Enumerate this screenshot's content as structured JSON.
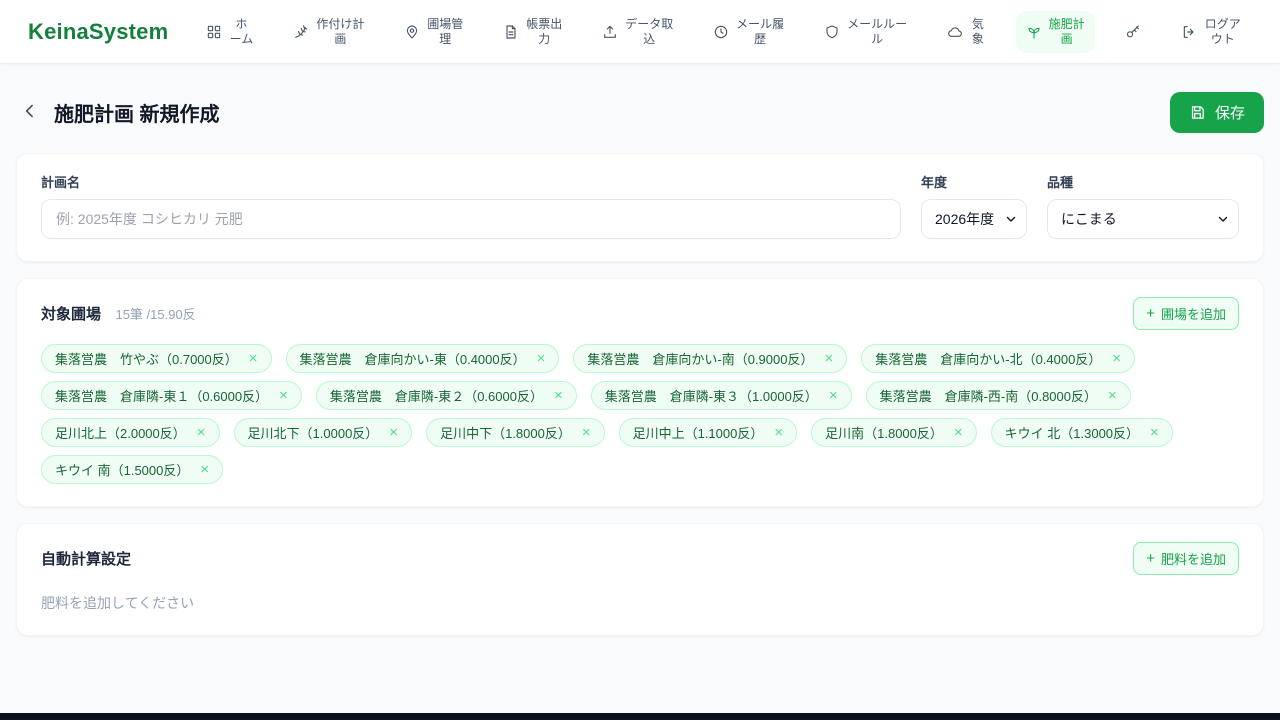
{
  "colors": {
    "accent": "#16a34a",
    "accent_dark": "#15803d",
    "accent_bg": "#f0fdf4",
    "accent_border": "#86efac",
    "tag_border": "#bbf7d0",
    "tag_text": "#166534",
    "text_dark": "#0f172a",
    "text_muted": "#94a3b8",
    "page_bg": "#f8fafc",
    "nav_text": "#475569"
  },
  "header": {
    "logo": "KeinaSystem",
    "nav": [
      {
        "label": "ホーム",
        "icon": "grid",
        "active": false
      },
      {
        "label": "作付け計画",
        "icon": "wheat",
        "active": false
      },
      {
        "label": "圃場管理",
        "icon": "map-pin",
        "active": false
      },
      {
        "label": "帳票出力",
        "icon": "document",
        "active": false
      },
      {
        "label": "データ取込",
        "icon": "upload",
        "active": false
      },
      {
        "label": "メール履歴",
        "icon": "history",
        "active": false
      },
      {
        "label": "メールルール",
        "icon": "shield",
        "active": false
      },
      {
        "label": "気象",
        "icon": "cloud",
        "active": false
      },
      {
        "label": "施肥計画",
        "icon": "sprout",
        "active": true
      },
      {
        "label": "",
        "icon": "key",
        "active": false
      },
      {
        "label": "ログアウト",
        "icon": "logout",
        "active": false
      }
    ]
  },
  "page": {
    "title": "施肥計画 新規作成",
    "save_label": "保存"
  },
  "form": {
    "plan_name_label": "計画名",
    "plan_name_placeholder": "例: 2025年度 コシヒカリ 元肥",
    "year_label": "年度",
    "year_value": "2026年度",
    "variety_label": "品種",
    "variety_value": "にこまる"
  },
  "fields_section": {
    "title": "対象圃場",
    "summary": "15筆 /15.90反",
    "add_button": "圃場を追加",
    "tags": [
      "集落営農　竹やぶ（0.7000反）",
      "集落営農　倉庫向かい-東（0.4000反）",
      "集落営農　倉庫向かい-南（0.9000反）",
      "集落営農　倉庫向かい-北（0.4000反）",
      "集落営農　倉庫隣-東１（0.6000反）",
      "集落営農　倉庫隣-東２（0.6000反）",
      "集落営農　倉庫隣-東３（1.0000反）",
      "集落営農　倉庫隣-西-南（0.8000反）",
      "足川北上（2.0000反）",
      "足川北下（1.0000反）",
      "足川中下（1.8000反）",
      "足川中上（1.1000反）",
      "足川南（1.8000反）",
      "キウイ 北（1.3000反）",
      "キウイ 南（1.5000反）"
    ]
  },
  "fertilizer_section": {
    "title": "自動計算設定",
    "add_button": "肥料を追加",
    "empty_text": "肥料を追加してください"
  }
}
